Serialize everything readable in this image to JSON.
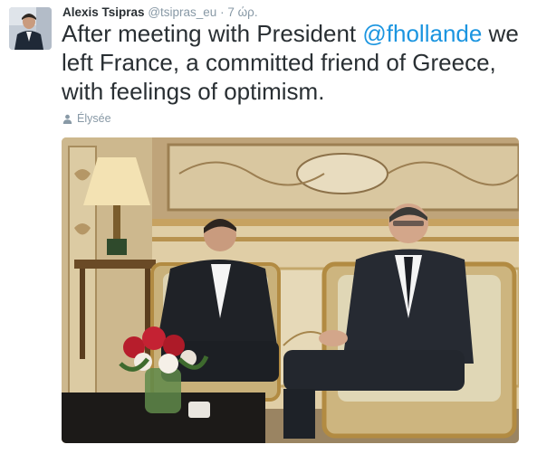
{
  "tweet": {
    "author_name": "Alexis Tsipras",
    "screen_name": "@tsipras_eu",
    "separator": "·",
    "time": "7 ώρ.",
    "text_before": "After meeting with President ",
    "mention": "@fhollande",
    "text_after": " we left France, a committed friend of Greece, with feelings of optimism.",
    "place": "Élysée"
  },
  "icons": {
    "place": "user-icon"
  },
  "colors": {
    "name": "#292f33",
    "meta": "#8899a6",
    "link": "#1b95e0"
  }
}
